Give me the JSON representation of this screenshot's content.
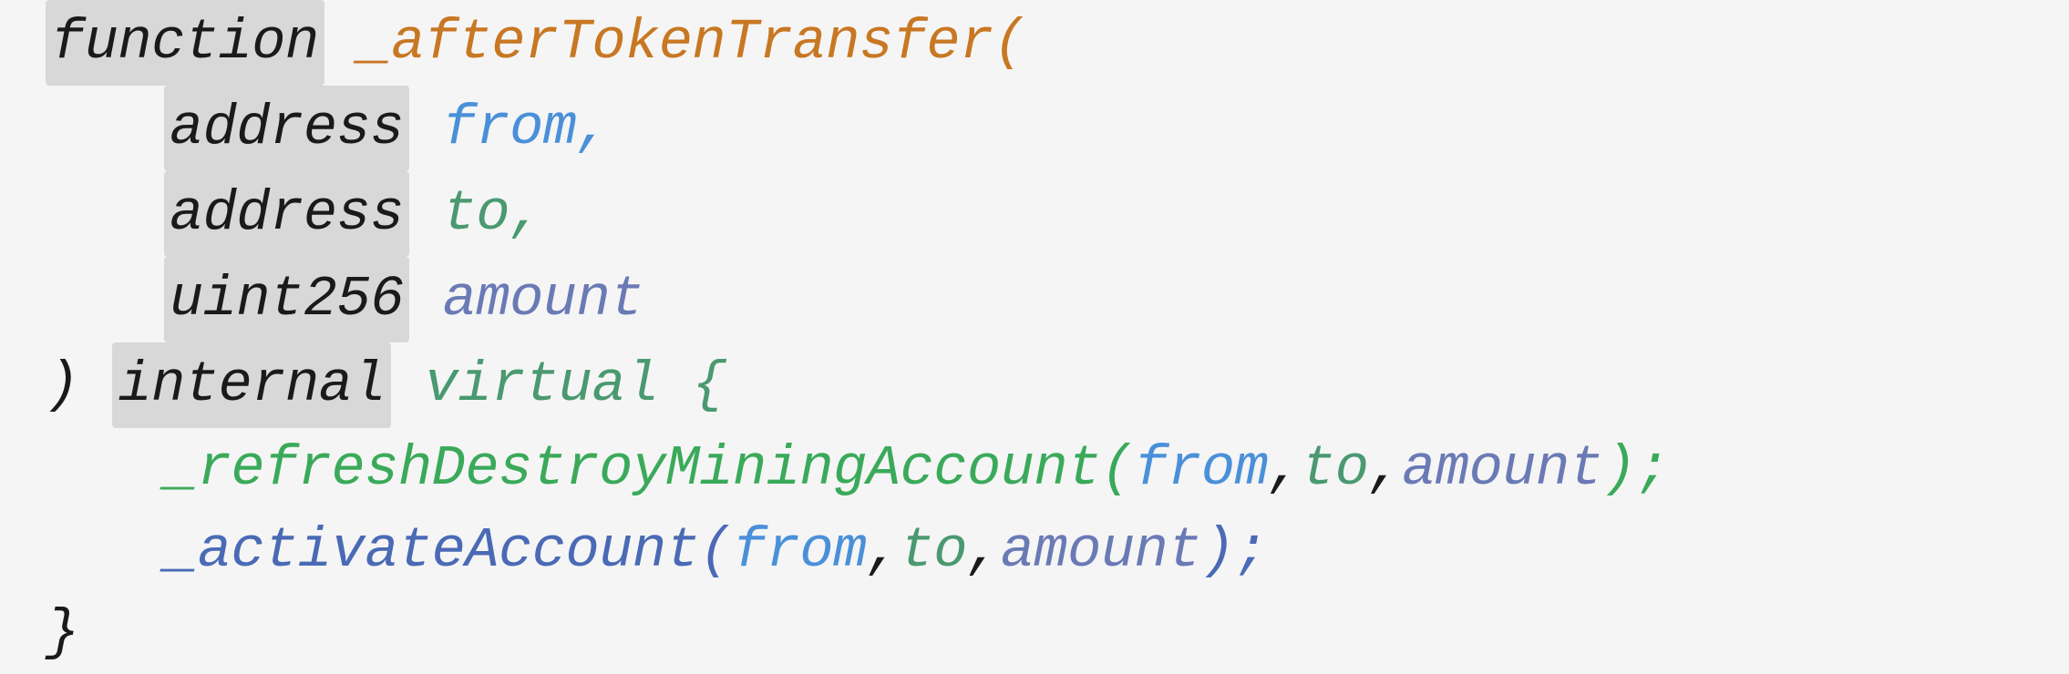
{
  "code": {
    "line1": {
      "keyword": "function",
      "space": " ",
      "name": "_afterTokenTransfer(",
      "bg": true
    },
    "line2": {
      "keyword": "address",
      "space": " ",
      "param": "from,",
      "indent": true,
      "bg": true
    },
    "line3": {
      "keyword": "address",
      "space": " ",
      "param": "to,",
      "indent": true,
      "bg": true
    },
    "line4": {
      "keyword": "uint256",
      "space": " ",
      "param": "amount",
      "indent": true,
      "bg": true
    },
    "line5": {
      "close": ") ",
      "keyword": "internal",
      "space": " ",
      "modifier": "virtual {",
      "bg": true
    },
    "line6": {
      "fn": "_refreshDestroyMiningAccount(",
      "args": "from",
      "comma1": ",",
      "arg2": "to",
      "comma2": ",",
      "arg3": "amount",
      "end": ");"
    },
    "line7": {
      "fn": "_activateAccount(",
      "args": "from",
      "comma1": ",",
      "arg2": "to",
      "comma2": ",",
      "arg3": "amount",
      "end": ");"
    },
    "line8": {
      "text": "}"
    }
  }
}
